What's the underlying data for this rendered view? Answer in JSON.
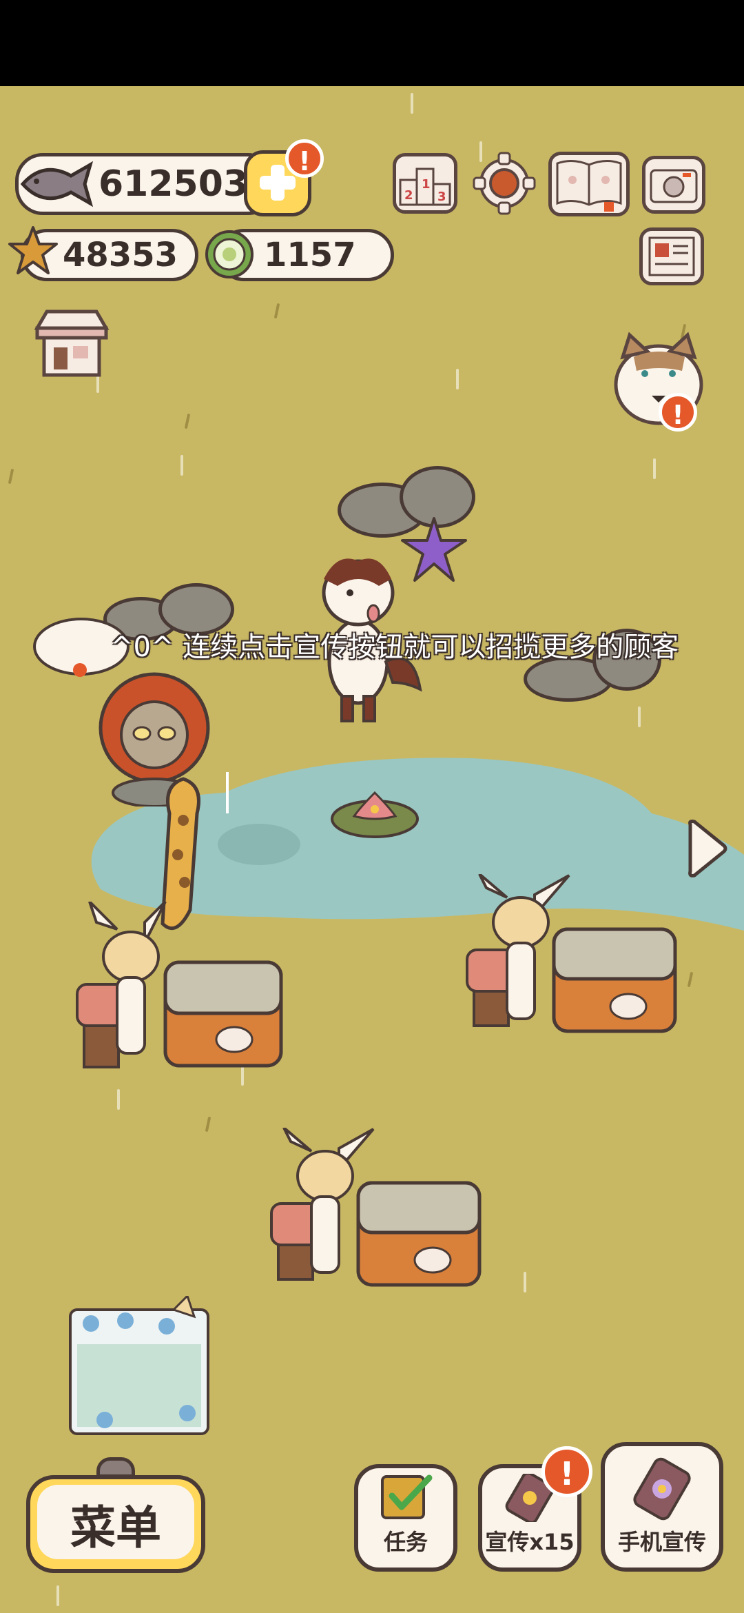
{
  "currencies": {
    "fish": "612503",
    "stars": "48353",
    "tickets": "1157"
  },
  "tip_text": "^0^ 连续点击宣传按钮就可以招揽更多的顾客",
  "bottom_bar": {
    "menu_label": "菜单",
    "tasks_label": "任务",
    "promote_label": "宣传x15",
    "phone_promote_label": "手机宣传"
  },
  "badges": {
    "add_badge": "!",
    "cat_badge": "!",
    "promote_badge": "!"
  },
  "icons": {
    "fish": "fish-icon",
    "star": "starfish-icon",
    "ticket": "ticket-icon",
    "plus": "plus-icon",
    "rank": "ranking-icon",
    "settings": "gear-icon",
    "book": "book-icon",
    "camera": "camera-icon",
    "news": "newspaper-icon",
    "shop": "shop-icon",
    "cat": "cat-helper-icon",
    "next": "arrow-right-icon"
  },
  "colors": {
    "background": "#c9b863",
    "pond": "#9ac7c2",
    "accent_orange": "#e5582a",
    "menu_yellow": "#ffd75a"
  }
}
